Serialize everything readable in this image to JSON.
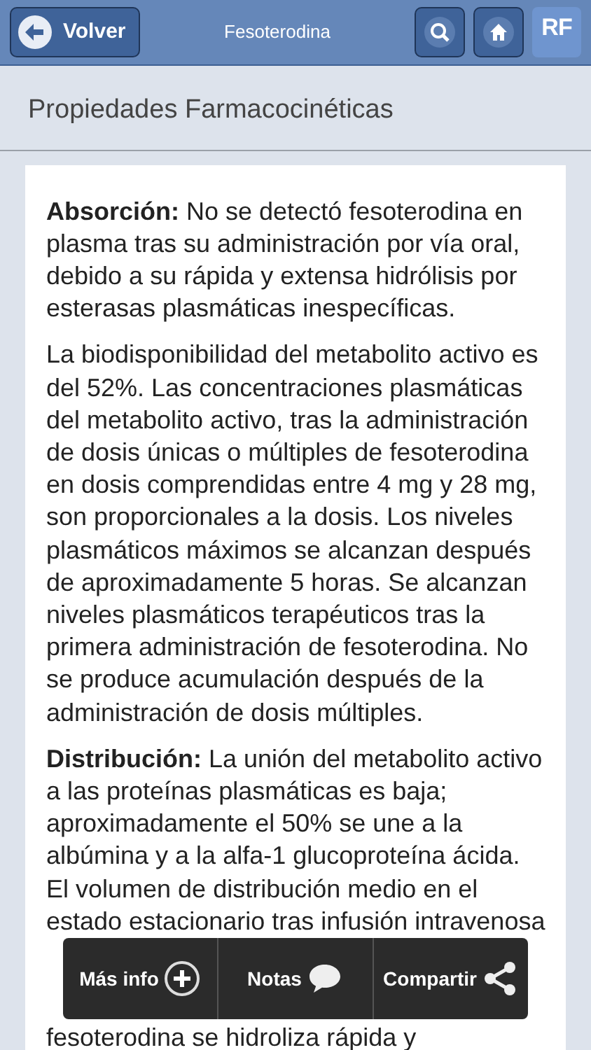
{
  "header": {
    "back_label": "Volver",
    "title": "Fesoterodina",
    "logo": "RF"
  },
  "section_title": "Propiedades Farmacocinéticas",
  "paragraphs": [
    {
      "lines": [
        "**Absorción:** No se detectó fesoterodina en",
        "plasma tras su administración por vía oral,",
        "debido a su rápida y extensa hidrólisis por",
        "esterasas plasmáticas inespecíficas."
      ]
    },
    {
      "lines": [
        "La biodisponibilidad del metabolito activo es",
        "del 52%. Las concentraciones plasmáticas",
        "del metabolito activo, tras la administración",
        "de dosis únicas o múltiples de fesoterodina",
        "en dosis comprendidas entre 4 mg y 28 mg,",
        "son proporcionales a la dosis. Los niveles",
        "plasmáticos máximos se alcanzan después",
        "de aproximadamente 5 horas. Se alcanzan",
        "niveles plasmáticos terapéuticos tras la",
        "primera administración de fesoterodina. No",
        "se produce acumulación después de la",
        "administración de dosis múltiples."
      ]
    },
    {
      "lines": [
        "**Distribución:** La unión del metabolito activo",
        "a las proteínas plasmáticas es baja;",
        "aproximadamente el 50% se une a la",
        "albúmina y a la alfa-1 glucoproteína ácida.",
        "El volumen de distribución medio en el",
        "estado estacionario tras infusión intravenosa"
      ]
    },
    {
      "lines": [
        "fesoterodina se hidroliza rápida y"
      ]
    }
  ],
  "actions": [
    {
      "label": "Más info",
      "kind": "plus"
    },
    {
      "label": "Notas",
      "kind": "comment"
    },
    {
      "label": "Compartir",
      "kind": "share"
    }
  ]
}
